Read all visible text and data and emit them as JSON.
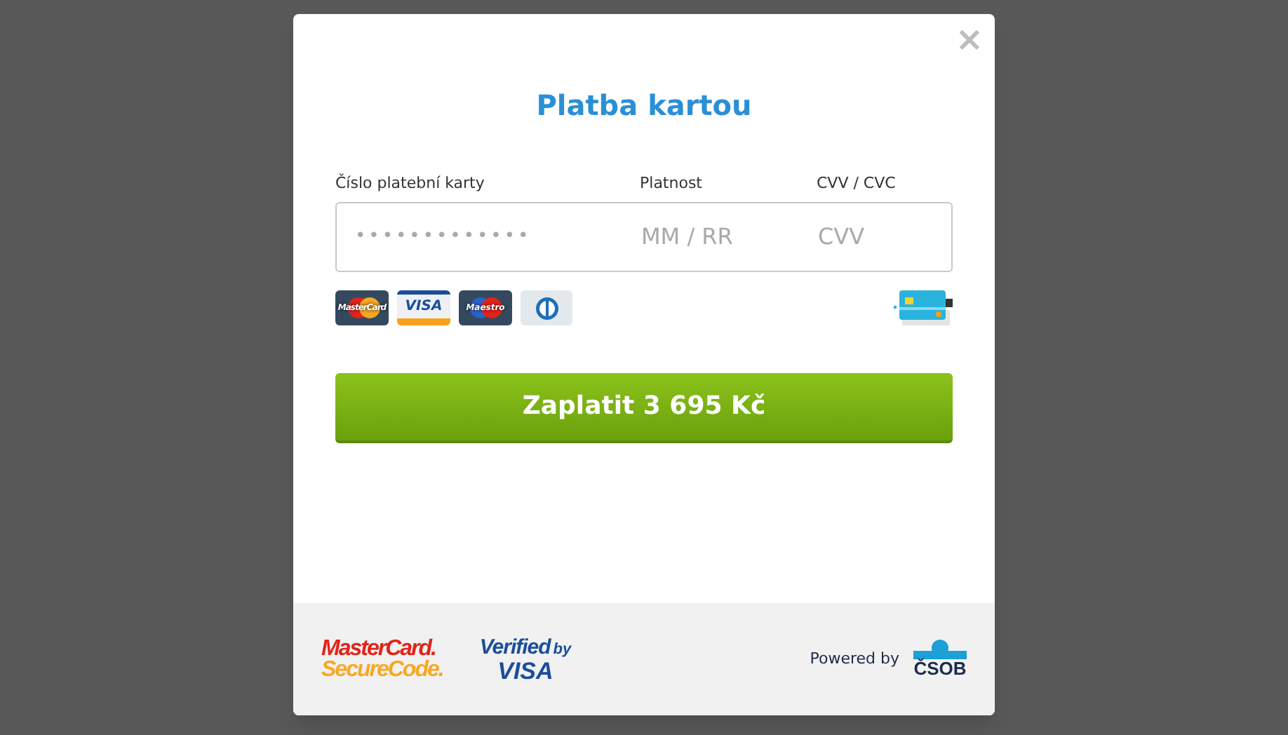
{
  "dialog": {
    "close": "×",
    "title": "Platba kartou"
  },
  "form": {
    "labels": [
      "Číslo platební karty",
      "Platnost",
      "CVV / CVC"
    ],
    "inputs": [
      {
        "kind": "number",
        "placeholder": "•••••••••••••"
      },
      {
        "kind": "expiry",
        "placeholder": "MM / RR"
      },
      {
        "kind": "cvv",
        "placeholder": "CVV"
      }
    ]
  },
  "card_brands": [
    {
      "kind": "mastercard",
      "label": "MasterCard"
    },
    {
      "kind": "visa",
      "label": "VISA"
    },
    {
      "kind": "maestro",
      "label": "Maestro"
    },
    {
      "kind": "diners"
    }
  ],
  "pay_button": "Zaplatit 3 695 Kč",
  "footer": {
    "mastercard_securecode": [
      "MasterCard.",
      "SecureCode."
    ],
    "verified_by_visa": [
      "Verified",
      "by",
      "VISA"
    ],
    "powered_by": "Powered by",
    "bank": "ČSOB"
  }
}
